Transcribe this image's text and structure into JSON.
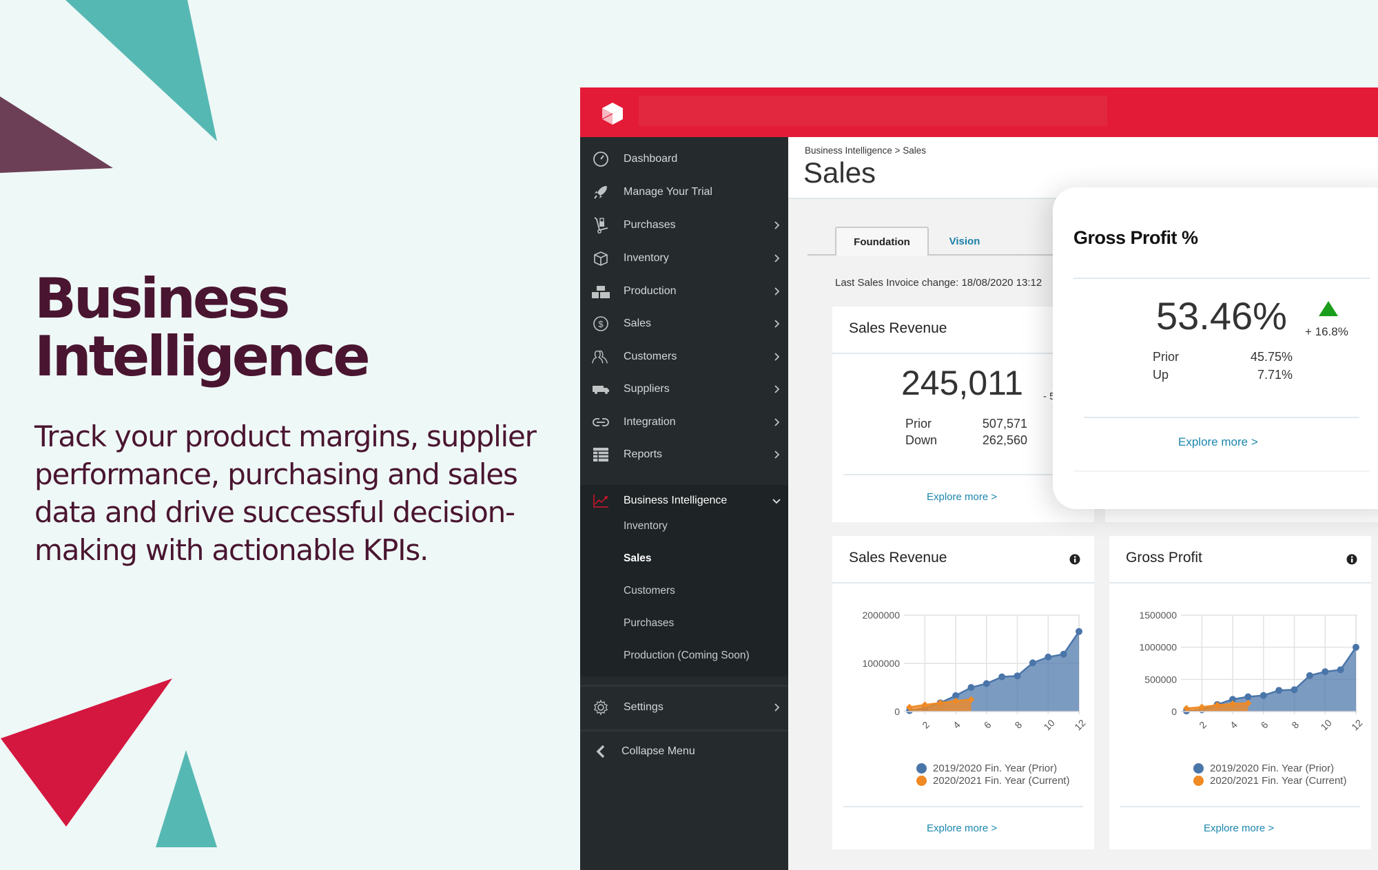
{
  "hero": {
    "title_line1": "Business",
    "title_line2": "Intelligence",
    "description": "Track your product margins, supplier performance, purchasing and sales data and drive successful decision-making with actionable KPIs."
  },
  "colors": {
    "brand_red": "#e31b37",
    "heading": "#4a1530",
    "teal": "#56b8b3",
    "plum": "#6d3f56",
    "crimson": "#d4173f",
    "sidebar_bg": "#252b2d",
    "link": "#1b86ad",
    "series_prior": "#4a75a9",
    "series_current": "#f08a24",
    "up_green": "#1b9e1b",
    "down_red": "#d9142d"
  },
  "sidebar": {
    "items": [
      {
        "label": "Dashboard",
        "icon": "dashboard-gauge-icon",
        "has_children": false
      },
      {
        "label": "Manage Your Trial",
        "icon": "rocket-icon",
        "has_children": false
      },
      {
        "label": "Purchases",
        "icon": "hand-truck-icon",
        "has_children": true
      },
      {
        "label": "Inventory",
        "icon": "box-icon",
        "has_children": true
      },
      {
        "label": "Production",
        "icon": "blocks-icon",
        "has_children": true
      },
      {
        "label": "Sales",
        "icon": "dollar-circle-icon",
        "has_children": true
      },
      {
        "label": "Customers",
        "icon": "people-icon",
        "has_children": true
      },
      {
        "label": "Suppliers",
        "icon": "truck-icon",
        "has_children": true
      },
      {
        "label": "Integration",
        "icon": "link-icon",
        "has_children": true
      },
      {
        "label": "Reports",
        "icon": "table-icon",
        "has_children": true
      }
    ],
    "bi": {
      "label": "Business Intelligence",
      "icon": "trend-chart-icon",
      "expanded": true,
      "children": [
        "Inventory",
        "Sales",
        "Customers",
        "Purchases",
        "Production (Coming Soon)"
      ],
      "current": "Sales"
    },
    "settings_label": "Settings",
    "collapse_label": "Collapse Menu"
  },
  "page": {
    "breadcrumb": "Business Intelligence > Sales",
    "title": "Sales",
    "tabs": [
      "Foundation",
      "Vision"
    ],
    "active_tab": "Foundation",
    "last_change": "Last Sales Invoice change: 18/08/2020 13:12"
  },
  "kpi_sales_revenue": {
    "title": "Sales Revenue",
    "value": "245,011",
    "change": "- 5",
    "trend": "down",
    "prior_label": "Prior",
    "prior_value": "507,571",
    "diff_label": "Down",
    "diff_value": "262,560",
    "explore": "Explore more >"
  },
  "kpi_gross_profit_pct": {
    "title": "Gross Profit %",
    "value": "53.46%",
    "change": "+ 16.8%",
    "trend": "up",
    "prior_label": "Prior",
    "prior_value": "45.75%",
    "diff_label": "Up",
    "diff_value": "7.71%",
    "explore": "Explore more >"
  },
  "chart_cards": [
    {
      "title": "Sales Revenue",
      "explore": "Explore more >"
    },
    {
      "title": "Gross Profit",
      "explore": "Explore more >"
    }
  ],
  "chart_data": [
    {
      "type": "area",
      "title": "Sales Revenue",
      "x": [
        1,
        2,
        3,
        4,
        5,
        6,
        7,
        8,
        9,
        10,
        11,
        12
      ],
      "xticks": [
        2,
        4,
        6,
        8,
        10,
        12
      ],
      "yticks": [
        0,
        1000000,
        2000000
      ],
      "ylim": [
        0,
        2000000
      ],
      "grid": true,
      "legend": "bottom",
      "series": [
        {
          "name": "2019/2020 Fin. Year (Prior)",
          "values": [
            20000,
            70000,
            180000,
            330000,
            500000,
            580000,
            720000,
            740000,
            1010000,
            1130000,
            1190000,
            1660000
          ]
        },
        {
          "name": "2020/2021 Fin. Year (Current)",
          "values": [
            90000,
            140000,
            180000,
            220000,
            250000
          ]
        }
      ]
    },
    {
      "type": "area",
      "title": "Gross Profit",
      "x": [
        1,
        2,
        3,
        4,
        5,
        6,
        7,
        8,
        9,
        10,
        11,
        12
      ],
      "xticks": [
        2,
        4,
        6,
        8,
        10,
        12
      ],
      "yticks": [
        0,
        500000,
        1000000,
        1500000
      ],
      "ylim": [
        0,
        1500000
      ],
      "grid": true,
      "legend": "bottom",
      "series": [
        {
          "name": "2019/2020 Fin. Year (Prior)",
          "values": [
            10000,
            30000,
            110000,
            190000,
            230000,
            250000,
            330000,
            340000,
            560000,
            620000,
            650000,
            1000000
          ]
        },
        {
          "name": "2020/2021 Fin. Year (Current)",
          "values": [
            50000,
            70000,
            100000,
            120000,
            130000
          ]
        }
      ]
    }
  ]
}
